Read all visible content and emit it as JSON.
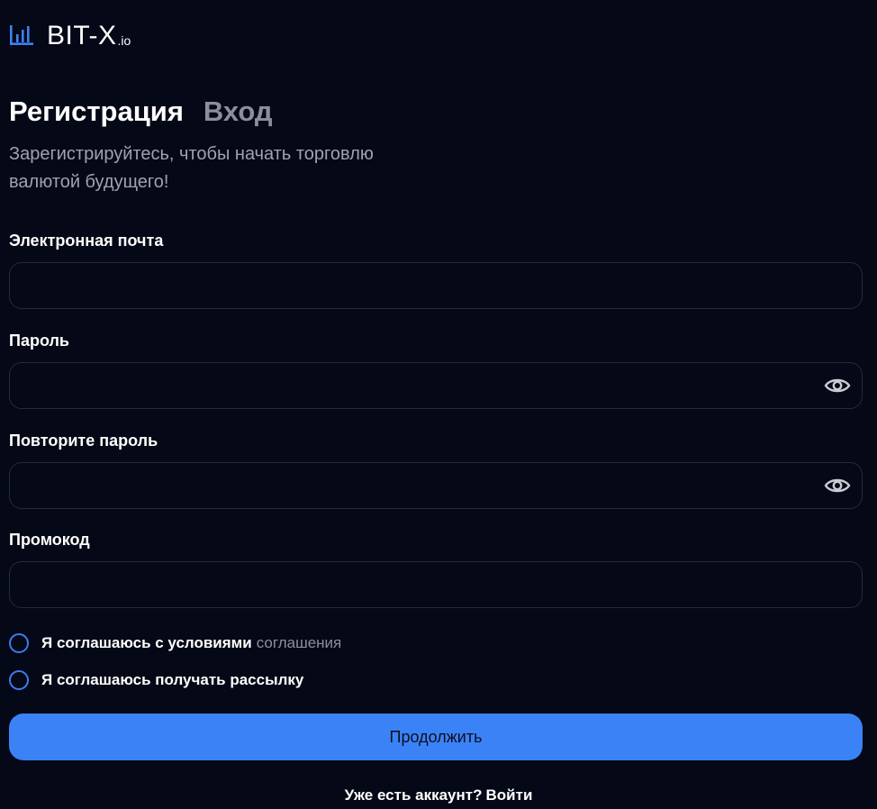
{
  "logo": {
    "main": "BIT-X",
    "suffix": ".io",
    "icon": "bar-chart-icon"
  },
  "tabs": [
    {
      "label": "Регистрация",
      "active": true
    },
    {
      "label": "Вход",
      "active": false
    }
  ],
  "subtitle": "Зарегистрируйтесь, чтобы начать торговлю валютой будущего!",
  "fields": {
    "email": {
      "label": "Электронная почта",
      "value": ""
    },
    "password": {
      "label": "Пароль",
      "value": "",
      "icon": "eye-icon"
    },
    "password_repeat": {
      "label": "Повторите пароль",
      "value": "",
      "icon": "eye-icon"
    },
    "promo": {
      "label": "Промокод",
      "value": ""
    }
  },
  "agreements": {
    "terms": {
      "text": "Я соглашаюсь с условиями",
      "link": "соглашения",
      "checked": false
    },
    "newsletter": {
      "text": "Я соглашаюсь получать рассылку",
      "checked": false
    }
  },
  "submit_label": "Продолжить",
  "footer": {
    "text": "Уже есть аккаунт?",
    "link": "Войти"
  },
  "colors": {
    "background": "#050816",
    "accent": "#3b82f6",
    "muted": "#8b8f9c",
    "border": "#262b38"
  }
}
